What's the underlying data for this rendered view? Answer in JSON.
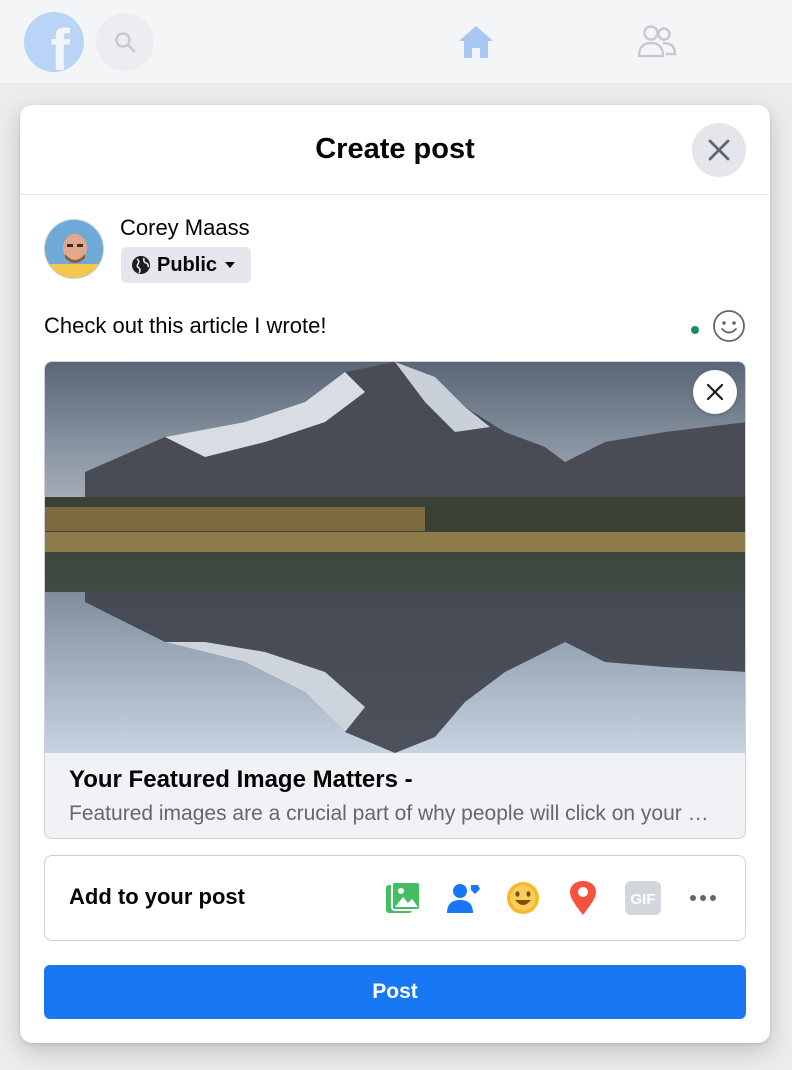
{
  "topbar": {
    "logo_letter": "f",
    "icons": [
      "facebook-logo-icon",
      "search-icon",
      "home-icon",
      "friends-icon"
    ]
  },
  "modal": {
    "title": "Create post",
    "close_icon": "close-icon"
  },
  "author": {
    "name": "Corey Maass",
    "privacy_label": "Public",
    "privacy_icon": "globe-icon"
  },
  "composer": {
    "text": "Check out this article I wrote!",
    "emoji_icon": "smiley-icon"
  },
  "link_preview": {
    "title": "Your Featured Image Matters -",
    "description": "Featured images are a crucial part of why people will click on your post",
    "remove_icon": "close-icon"
  },
  "add_to_post": {
    "label": "Add to your post",
    "items": [
      {
        "name": "photo-video-icon",
        "color": "#45bd62"
      },
      {
        "name": "tag-people-icon",
        "color": "#1877f2"
      },
      {
        "name": "feeling-activity-icon",
        "color": "#f7b928"
      },
      {
        "name": "check-in-icon",
        "color": "#f5533d"
      },
      {
        "name": "gif-icon",
        "label": "GIF",
        "color": "#bcc0c4"
      },
      {
        "name": "more-icon",
        "color": "#606770"
      }
    ]
  },
  "post_button": {
    "label": "Post",
    "color": "#1877f2"
  }
}
